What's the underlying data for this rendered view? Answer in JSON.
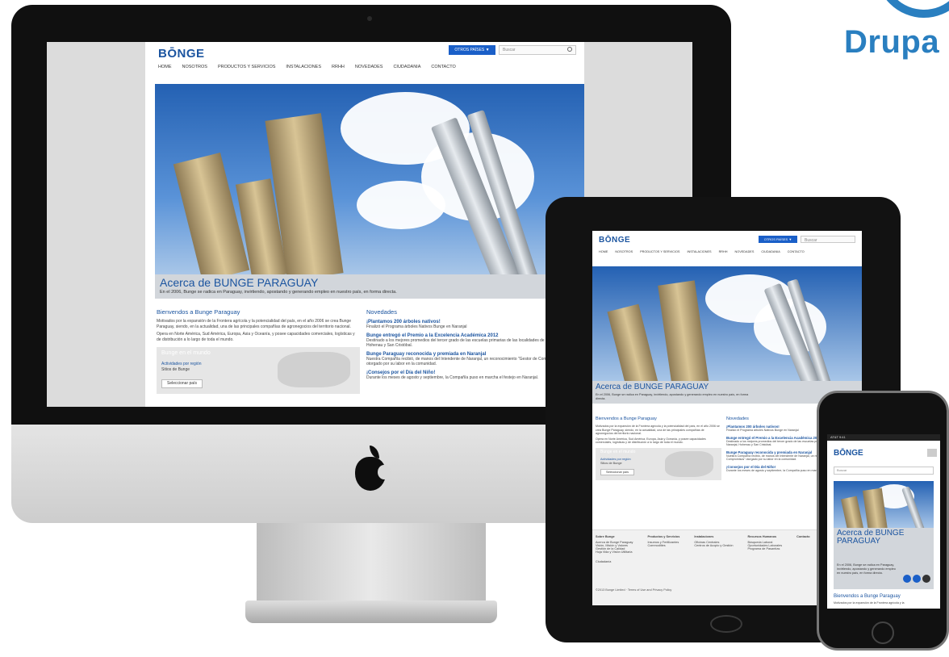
{
  "brand": {
    "drupal_word": "Drupa"
  },
  "site": {
    "logo": "BŌNGE",
    "otros_button": "OTROS PAÍSES  ▼",
    "search_placeholder": "Buscar",
    "nav": [
      "HOME",
      "NOSOTROS",
      "PRODUCTOS Y SERVICIOS",
      "INSTALACIONES",
      "RRHH",
      "NOVEDADES",
      "CIUDADANIA",
      "CONTACTO"
    ],
    "hero_title": "Acerca de  BUNGE PARAGUAY",
    "hero_text": "En el 2006, Bunge se radica en Paraguay, invirtiendo, apostando y generando empleo en nuestro país, en forma directa.",
    "welcome_title": "Bienvendos a Bunge Paraguay",
    "welcome_p1": "Motivados por la expansión de la Frontera agrícola y la potencialidad del país, en el año 2006 se crea Bunge Paraguay, siendo, en la actualidad, una de las principales compañías de agronegocios del territorio nacional.",
    "welcome_p2": "Opera en Norte América, Sud América, Europa, Asia y Oceanía, y posee capacidades comerciales, logísticas y de distribución a lo largo de toda el mundo.",
    "map_title": "Bunge en el mundo",
    "map_label": "Actividades por región",
    "map_label2": "Sitios de Bunge",
    "map_button": "Seleccionar país",
    "news_title": "Novedades",
    "news": [
      {
        "title": "¡Plantamos 200 árboles nativos!",
        "desc": "Finalizó el Programa árboles Nativos Bunge en Naranjal"
      },
      {
        "title": "Bunge entregó el Premio a la Excelencia Académica 2012",
        "desc": "Destinado a los mejores promedios del tercer grado de las escuelas primarias de las localidades de Naranjal, Hohenau y San Cristóbal."
      },
      {
        "title": "Bunge Paraguay reconocida y premiada en Naranjal",
        "desc": "Nuestra Compañía recibió, de manos del Intendente de Naranjal, un reconocimiento \"Gestor de Compromisos\" otorgado por su labor en la comunidad."
      },
      {
        "title": "¡Consejos por el Día del Niño!",
        "desc": "Durante los meses de agosto y septiembre, la Compañía puso en marcha el festejo en Naranjal."
      }
    ]
  },
  "ipad_footer": {
    "columns": [
      {
        "title": "Sobre Bunge",
        "items": [
          "Acerca de Bunge Paraguay",
          "Visión, Misión y Valores",
          "Gestión de la Calidad",
          "Hoja Vida y Visión Utilitaria"
        ]
      },
      {
        "title": "Productos y Servicios",
        "items": [
          "Insumos y Fertilizantes",
          "Commodities"
        ]
      },
      {
        "title": "Instalaciones",
        "items": [
          "Oficinas Centrales",
          "Centros de Acopio y Gestión"
        ]
      },
      {
        "title": "Recursos Humanos",
        "items": [
          "Búsqueda Laboral",
          "Oportunidades Laborales",
          "Programa de Pasantías"
        ]
      },
      {
        "title": "Contacto",
        "items": []
      }
    ],
    "extra": "Ciudadanía",
    "legal": "©2013 Bunge Limited · Terms of Use and Privacy Policy"
  },
  "iphone": {
    "status": "AT&T  9:41",
    "hero_title": "Acerca de BUNGE PARAGUAY",
    "hero_text": "En el 2006, Bunge se radica en Paraguay, invirtiendo, apostando y generando empleo en nuestro país, en forma directa.",
    "welcome": "Bienvendos a Bunge Paraguay",
    "welcome_desc": "Motivados por la expansión de la Frontera agrícola y la"
  },
  "colors": {
    "brand_blue": "#1c55a0",
    "drupal_blue": "#2a7fc0",
    "button_blue": "#1a5fc8"
  },
  "icons": [
    "apple-logo-icon",
    "search-icon",
    "drupal-drop-icon",
    "world-map-icon"
  ]
}
